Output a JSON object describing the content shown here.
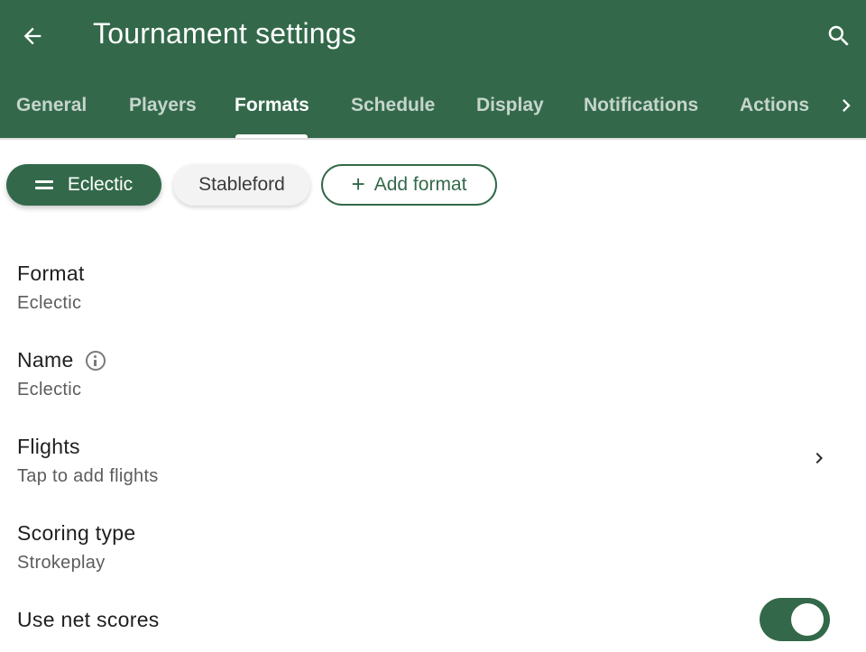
{
  "colors": {
    "primary": "#33694a",
    "on_primary": "#ffffff"
  },
  "appbar": {
    "title": "Tournament settings",
    "back_icon": "arrow-left-icon",
    "search_icon": "search-icon"
  },
  "tabs": [
    {
      "label": "General",
      "active": false
    },
    {
      "label": "Players",
      "active": false
    },
    {
      "label": "Formats",
      "active": true
    },
    {
      "label": "Schedule",
      "active": false
    },
    {
      "label": "Display",
      "active": false
    },
    {
      "label": "Notifications",
      "active": false
    },
    {
      "label": "Actions",
      "active": false
    }
  ],
  "chips": {
    "eclectic": "Eclectic",
    "stableford": "Stableford",
    "add_format": "Add format"
  },
  "settings": {
    "format": {
      "title": "Format",
      "value": "Eclectic"
    },
    "name": {
      "title": "Name",
      "value": "Eclectic"
    },
    "flights": {
      "title": "Flights",
      "value": "Tap to add flights"
    },
    "scoring_type": {
      "title": "Scoring type",
      "value": "Strokeplay"
    },
    "use_net_scores": {
      "title": "Use net scores",
      "enabled": true
    }
  }
}
